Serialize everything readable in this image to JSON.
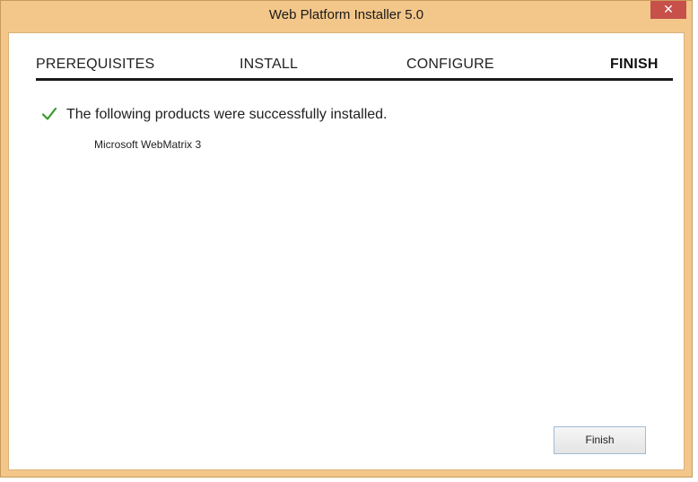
{
  "window": {
    "title": "Web Platform Installer 5.0",
    "close_glyph": "✕"
  },
  "steps": [
    {
      "label": "PREREQUISITES",
      "active": false
    },
    {
      "label": "INSTALL",
      "active": false
    },
    {
      "label": "CONFIGURE",
      "active": false
    },
    {
      "label": "FINISH",
      "active": true
    }
  ],
  "result": {
    "icon": "check-icon",
    "message": "The following products were successfully installed.",
    "products": [
      "Microsoft WebMatrix 3"
    ]
  },
  "actions": {
    "finish_label": "Finish"
  },
  "colors": {
    "frame": "#f3c78a",
    "check": "#3a9a2f",
    "close": "#c7504b"
  }
}
